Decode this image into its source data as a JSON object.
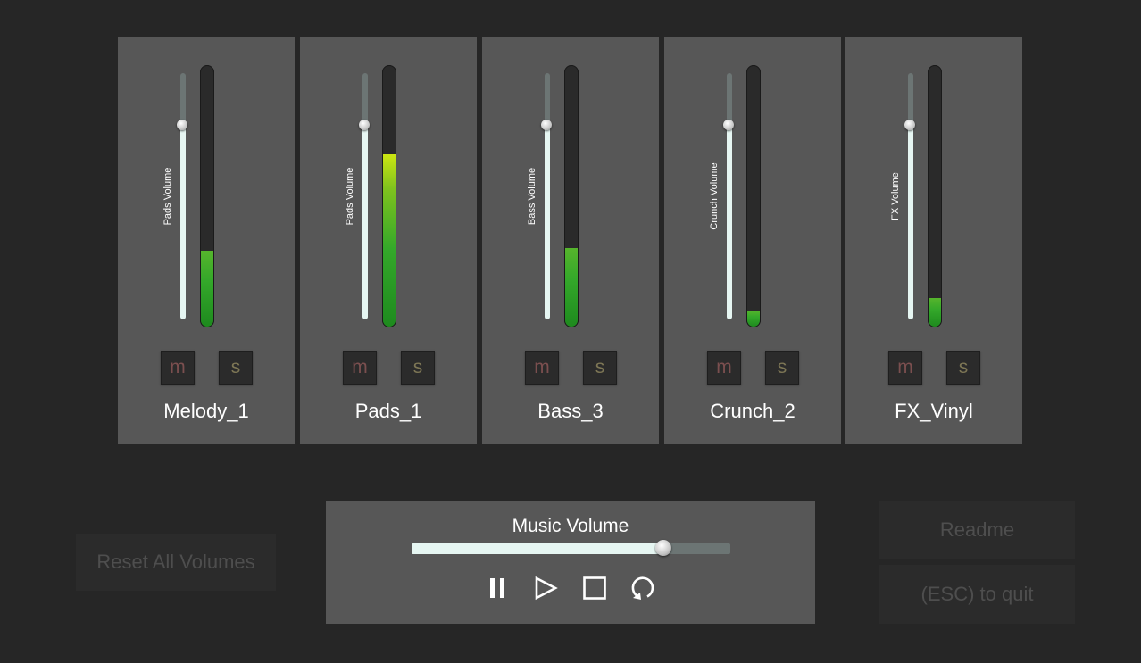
{
  "channels": [
    {
      "name": "Melody_1",
      "slider_label": "Pads Volume",
      "volume": 0.79,
      "meter": 0.29,
      "mute": "m",
      "solo": "s",
      "hot": false
    },
    {
      "name": "Pads_1",
      "slider_label": "Pads Volume",
      "volume": 0.79,
      "meter": 0.66,
      "mute": "m",
      "solo": "s",
      "hot": true
    },
    {
      "name": "Bass_3",
      "slider_label": "Bass Volume",
      "volume": 0.79,
      "meter": 0.3,
      "mute": "m",
      "solo": "s",
      "hot": false
    },
    {
      "name": "Crunch_2",
      "slider_label": "Crunch Volume",
      "volume": 0.79,
      "meter": 0.06,
      "mute": "m",
      "solo": "s",
      "hot": false
    },
    {
      "name": "FX_Vinyl",
      "slider_label": "FX Volume",
      "volume": 0.79,
      "meter": 0.11,
      "mute": "m",
      "solo": "s",
      "hot": false
    }
  ],
  "reset_button": "Reset All Volumes",
  "music": {
    "title": "Music Volume",
    "volume": 0.79,
    "controls": [
      "pause-icon",
      "play-icon",
      "stop-icon",
      "loop-icon"
    ]
  },
  "readme_button": "Readme",
  "quit_button": "(ESC) to quit",
  "colors": {
    "background": "#262626",
    "panel": "#575757",
    "slider_fill": "#e6f6f2",
    "meter_green": "#34a82a",
    "meter_hot": "#cce612",
    "mute_text": "#7b4f4f",
    "solo_text": "#7d7655",
    "button_bg": "#2b2b2b",
    "button_text": "#4e4e4e"
  }
}
